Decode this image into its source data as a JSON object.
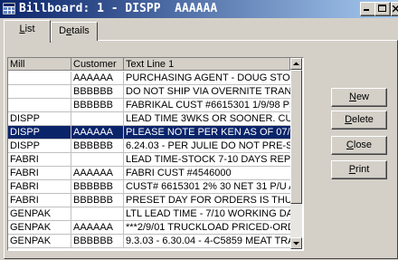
{
  "window": {
    "title": "Billboard: 1 - DISPP  AAAAAA"
  },
  "tabs": [
    {
      "label_prefix": "",
      "accel": "L",
      "label_rest": "ist",
      "active": true
    },
    {
      "label_prefix": "D",
      "accel": "e",
      "label_rest": "tails",
      "active": false
    }
  ],
  "grid": {
    "columns": [
      "Mill",
      "Customer",
      "Text Line 1"
    ],
    "rows": [
      [
        "",
        "AAAAAA",
        "PURCHASING AGENT - DOUG STONE"
      ],
      [
        "",
        "BBBBBB",
        "DO NOT SHIP VIA OVERNITE TRANPORT/YE"
      ],
      [
        "",
        "BBBBBB",
        "FABRIKAL CUST #6615301  1/9/98 PER DO"
      ],
      [
        "DISPP",
        "",
        "LEAD TIME 3WKS OR SOONER. CURRENT L"
      ],
      [
        "DISPP",
        "AAAAAA",
        "PLEASE NOTE PER KEN AS OF 07/06/01- M"
      ],
      [
        "DISPP",
        "BBBBBB",
        "6.24.03 - PER JULIE DO NOT PRE-SET DISP("
      ],
      [
        "FABRI",
        "",
        "LEAD TIME-STOCK 7-10 DAYS REPEAT PRI"
      ],
      [
        "FABRI",
        "AAAAAA",
        "FABRI CUST #4546000"
      ],
      [
        "FABRI",
        "BBBBBB",
        "CUST# 6615301 2% 30 NET 31 P/U ALLOW"
      ],
      [
        "FABRI",
        "BBBBBB",
        "PRESET DAY FOR ORDERS IS THURSDAY"
      ],
      [
        "GENPAK",
        "",
        "LTL LEAD TIME - 7/10 WORKING DAYS**T/L"
      ],
      [
        "GENPAK",
        "AAAAAA",
        "***2/9/01 TRUCKLOAD PRICED-ORDERS T/L"
      ],
      [
        "GENPAK",
        "BBBBBB",
        "9.3.03 - 6.30.04 - 4-C5859 MEAT TRAYS 3("
      ]
    ],
    "selected_index": 4
  },
  "buttons": {
    "new": {
      "accel": "N",
      "rest": "ew"
    },
    "delete": {
      "accel": "D",
      "rest": "elete"
    },
    "close": {
      "accel": "C",
      "rest": "lose"
    },
    "print": {
      "accel": "P",
      "rest": "rint"
    }
  }
}
